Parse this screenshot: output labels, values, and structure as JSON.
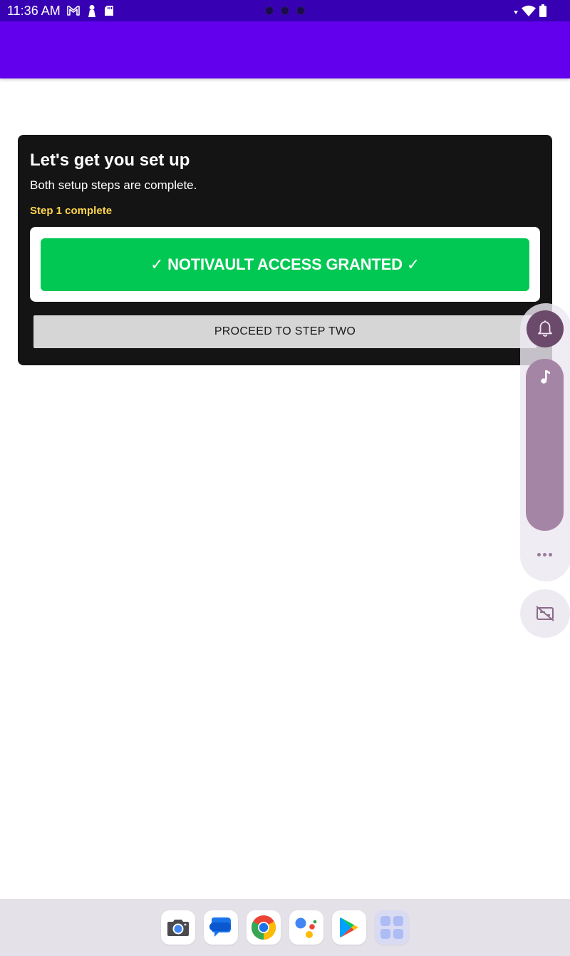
{
  "status_bar": {
    "time": "11:36 AM",
    "icons": [
      "gmail-icon",
      "keyguard-icon",
      "sd-card-icon",
      "camera-dots",
      "data-arrows-icon",
      "wifi-icon",
      "battery-icon"
    ]
  },
  "setup": {
    "title": "Let's get you set up",
    "subtitle": "Both setup steps are complete.",
    "step_status": "Step 1 complete",
    "granted_label": "✓ NOTIVAULT ACCESS GRANTED ✓",
    "proceed_label": "PROCEED TO STEP TWO"
  },
  "volume_panel": {
    "icons": [
      "bell-icon",
      "music-note-icon",
      "more-dots-icon",
      "captions-off-icon"
    ]
  },
  "dock": {
    "apps": [
      "camera-app-icon",
      "messages-app-icon",
      "chrome-app-icon",
      "assistant-app-icon",
      "play-store-app-icon",
      "all-apps-icon"
    ]
  },
  "colors": {
    "status_bar": "#3700b3",
    "app_bar": "#6200ee",
    "card_bg": "#141414",
    "step_status": "#ffd54f",
    "granted_bg": "#00c853",
    "proceed_bg": "#d6d6d6",
    "volume_slider": "#a585a6"
  }
}
